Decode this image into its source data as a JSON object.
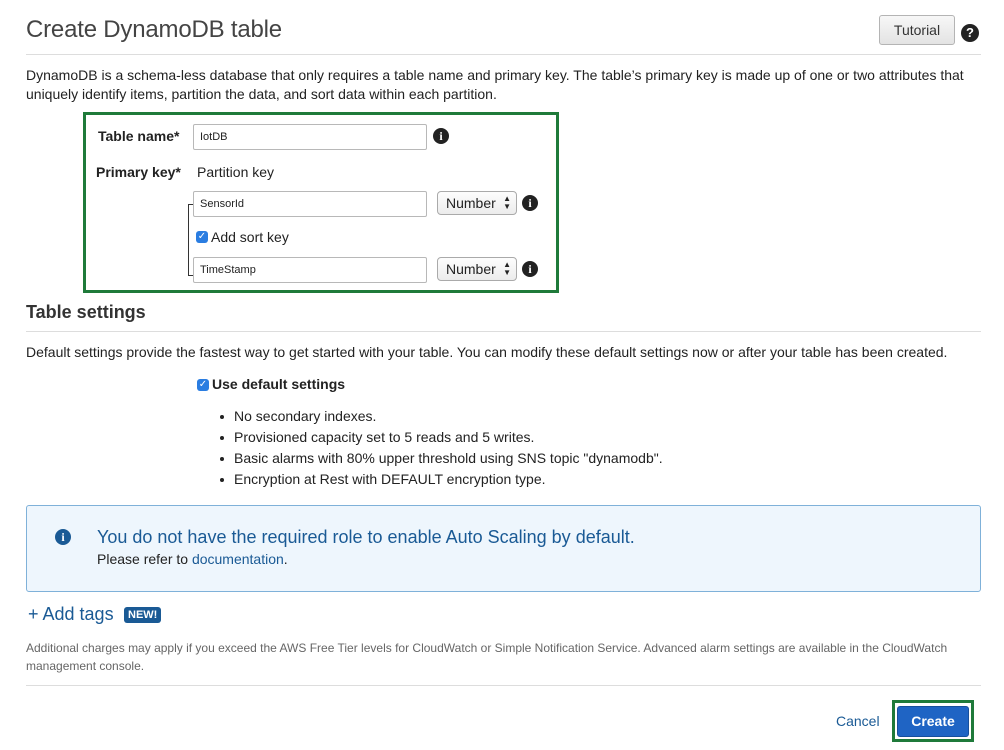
{
  "header": {
    "title": "Create DynamoDB table",
    "tutorial_label": "Tutorial",
    "help_icon": "question-icon"
  },
  "intro": "DynamoDB is a schema-less database that only requires a table name and primary key. The table’s primary key is made up of one or two attributes that uniquely identify items, partition the data, and sort data within each partition.",
  "key_section": {
    "table_name_label": "Table name*",
    "table_name_value": "IotDB",
    "primary_key_label": "Primary key*",
    "partition_key_label": "Partition key",
    "partition_key_value": "SensorId",
    "partition_key_type": "Number",
    "add_sort_key_label": "Add sort key",
    "add_sort_key_checked": true,
    "sort_key_value": "TimeStamp",
    "sort_key_type": "Number",
    "info_icon": "i"
  },
  "table_settings": {
    "title": "Table settings",
    "description": "Default settings provide the fastest way to get started with your table. You can modify these default settings now or after your table has been created.",
    "use_default_label": "Use default settings",
    "use_default_checked": true,
    "bullets": [
      "No secondary indexes.",
      "Provisioned capacity set to 5 reads and 5 writes.",
      "Basic alarms with 80% upper threshold using SNS topic \"dynamodb\".",
      "Encryption at Rest with DEFAULT encryption type."
    ]
  },
  "alert": {
    "title": "You do not have the required role to enable Auto Scaling by default.",
    "text_prefix": "Please refer to",
    "link_label": "documentation",
    "text_suffix": "."
  },
  "tags": {
    "add_label": "+ Add tags",
    "badge": "NEW!"
  },
  "charges_note": "Additional charges may apply if you exceed the AWS Free Tier levels for CloudWatch or Simple Notification Service. Advanced alarm settings are available in the CloudWatch management console.",
  "footer": {
    "cancel_label": "Cancel",
    "create_label": "Create"
  },
  "colors": {
    "highlight_border": "#1f7a3a",
    "link": "#1a5a95",
    "primary_button": "#1f64c4",
    "alert_bg": "#eef6fd"
  }
}
